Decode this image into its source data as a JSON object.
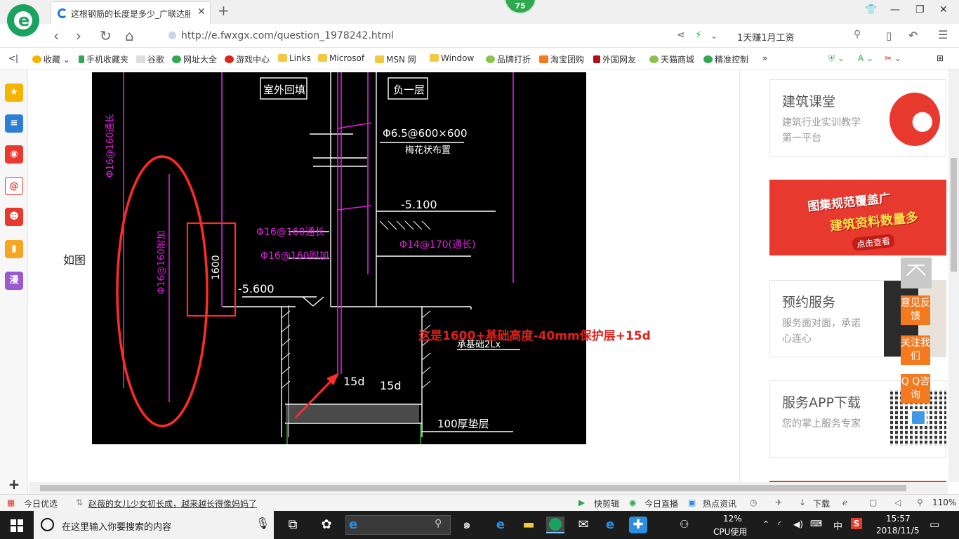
{
  "browser": {
    "tab_title": "这根钢筋的长度是多少_广联达服",
    "badge": "75",
    "url": "http://e.fwxgx.com/question_1978242.html",
    "search_text": "1天赚1月工资"
  },
  "bookmarks": [
    "收藏",
    "手机收藏夹",
    "谷歌",
    "网址大全",
    "游戏中心",
    "Links",
    "Microsof",
    "MSN 网",
    "Window",
    "品牌打折",
    "淘宝团购",
    "外国网友",
    "天猫商城",
    "精准控制"
  ],
  "sidebar_items": [
    "star-icon",
    "feed-icon",
    "weibo-icon",
    "mail-icon",
    "game-icon",
    "book-icon",
    "漫"
  ],
  "content": {
    "intro_text": "如图",
    "cad_labels": {
      "outdoor_backfill": "室外回填",
      "basement": "负一层",
      "tie_bars": "Φ6.5@600×600",
      "tie_note": "梅花状布置",
      "level_top": "-5.100",
      "through_left": "Φ16@160通长",
      "through_right": "Φ14@170(通长)",
      "added_bar": "Φ16@160附加",
      "dim_1600": "1600",
      "level_bottom": "-5.600",
      "foundation": "承基础2Lx",
      "anchor_left": "15d",
      "anchor_right": "15d",
      "cushion": "100厚垫层",
      "circled_label": "Φ16@160附加",
      "top_left_label": "Φ16@160通长"
    },
    "annotation": "这是1600+基础高度-40mm保护层+15d"
  },
  "right_panel": {
    "cards": [
      {
        "title": "建筑课堂",
        "desc": "建筑行业实训教学第一平台"
      },
      {
        "title": "预约服务",
        "desc": "服务面对面，承诺心连心"
      },
      {
        "title": "服务APP下载",
        "desc": "您的掌上服务专家"
      }
    ],
    "banner": {
      "line1": "图集规范覆盖广",
      "line2": "建筑资料数量多",
      "cta": "点击查看"
    },
    "float_buttons": [
      "意见反馈",
      "关注我们",
      "Q Q咨询"
    ]
  },
  "statusbar": {
    "left": "今日优选",
    "news": "赵薇的女儿少女初长成，越来越长得像妈妈了",
    "items": [
      "快剪辑",
      "今日直播",
      "热点资讯",
      "下载"
    ],
    "zoom": "110%"
  },
  "taskbar": {
    "search_placeholder": "在这里输入你要搜索的内容",
    "cpu_percent": "12%",
    "cpu_label": "CPU使用",
    "ime": "中",
    "time": "15:57",
    "date": "2018/11/5"
  },
  "colors": {
    "accent_green": "#1aa260",
    "annotation_red": "#e0201b",
    "cad_magenta": "#e020e0",
    "float_orange": "#f47a20"
  }
}
